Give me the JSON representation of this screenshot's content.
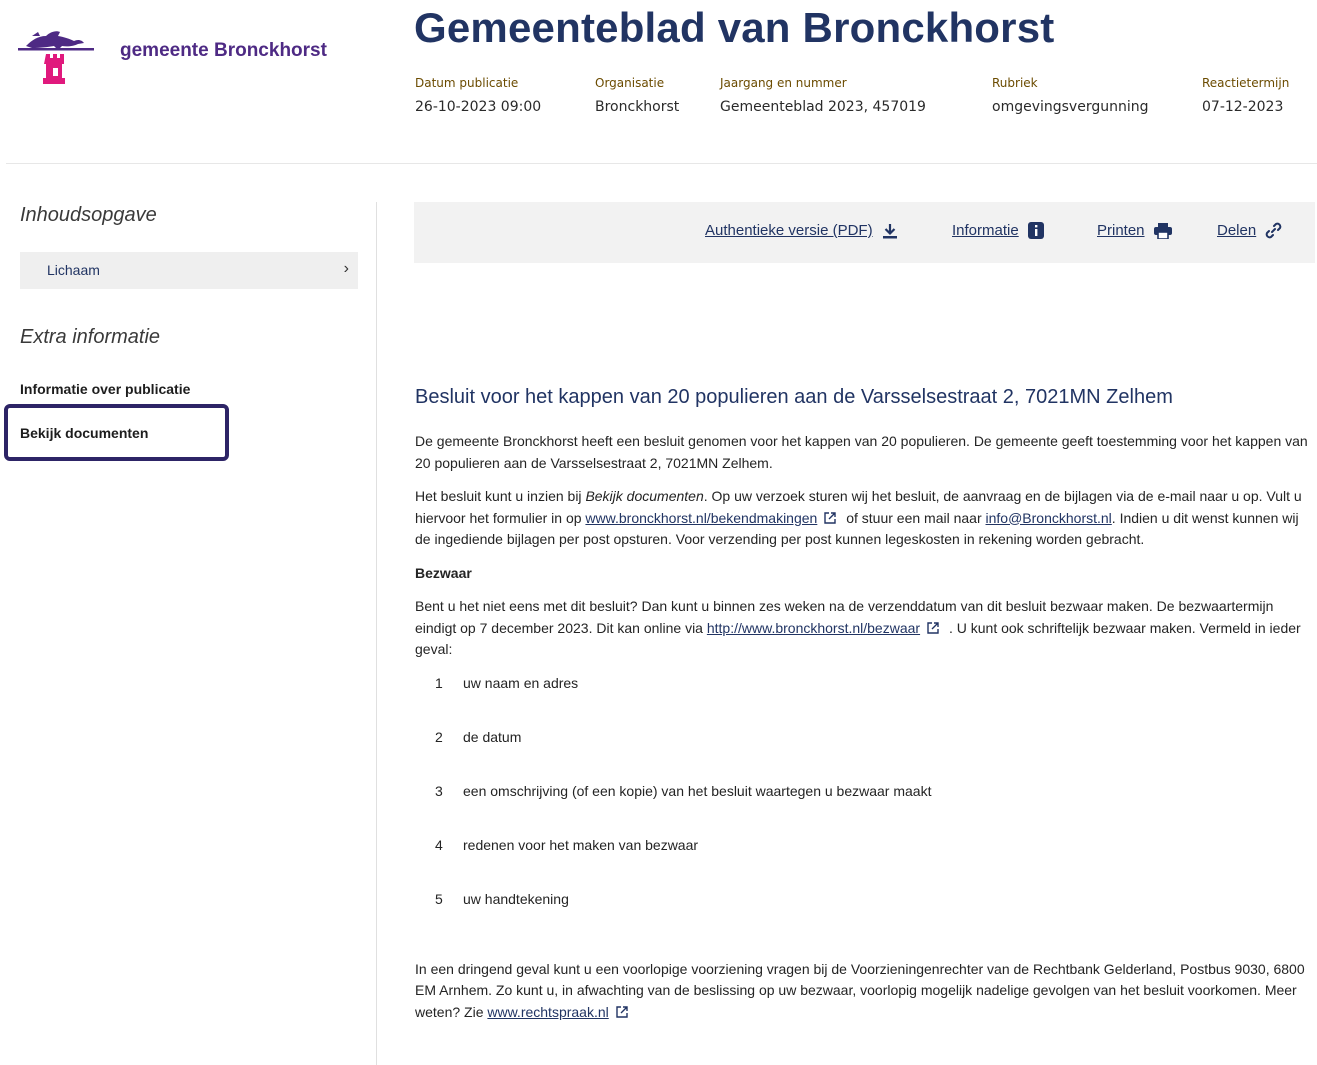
{
  "header": {
    "logo_text": "gemeente Bronckhorst",
    "title": "Gemeenteblad van Bronckhorst",
    "meta": [
      {
        "label": "Datum publicatie",
        "value": "26-10-2023 09:00"
      },
      {
        "label": "Organisatie",
        "value": "Bronckhorst"
      },
      {
        "label": "Jaargang en nummer",
        "value": "Gemeenteblad 2023, 457019"
      },
      {
        "label": "Rubriek",
        "value": "omgevingsvergunning"
      },
      {
        "label": "Reactietermijn",
        "value": "07-12-2023"
      }
    ]
  },
  "sidebar": {
    "toc_heading": "Inhoudsopgave",
    "toc_item": "Lichaam",
    "extra_heading": "Extra informatie",
    "links": [
      "Informatie over publicatie",
      "Bekijk documenten"
    ]
  },
  "toolbar": {
    "pdf": "Authentieke versie (PDF)",
    "info": "Informatie",
    "print": "Printen",
    "share": "Delen"
  },
  "content": {
    "heading": "Besluit voor het kappen van 20 populieren aan de Varsselsestraat 2, 7021MN Zelhem",
    "intro": "De gemeente Bronckhorst heeft een besluit genomen voor het kappen van 20 populieren. De gemeente geeft toestemming voor het kappen van 20 populieren aan de Varsselsestraat 2, 7021MN Zelhem.",
    "p2": {
      "a": "Het besluit kunt u inzien bij ",
      "em": "Bekijk documenten",
      "b": ". Op uw verzoek sturen wij het besluit, de aanvraag en de bijlagen via de e-mail naar u op. Vult u hiervoor het formulier in op ",
      "link1": "www.bronckhorst.nl/bekendmakingen",
      "c": " of stuur een mail naar ",
      "link2": "info@Bronckhorst.nl",
      "d": ". Indien u dit wenst kunnen wij de ingediende bijlagen per post opsturen. Voor verzending per post kunnen legeskosten in rekening worden gebracht."
    },
    "bezwaar_heading": "Bezwaar",
    "p3": {
      "a": "Bent u het niet eens met dit besluit? Dan kunt u binnen zes weken na de verzenddatum van dit besluit bezwaar maken. De bezwaartermijn eindigt op 7 december 2023. Dit kan online via ",
      "link": "http://www.bronckhorst.nl/bezwaar",
      "b": " . U kunt ook schriftelijk bezwaar maken. Vermeld in ieder geval:"
    },
    "steps": [
      {
        "n": "1",
        "text": "uw naam en adres"
      },
      {
        "n": "2",
        "text": "de datum"
      },
      {
        "n": "3",
        "text": "een omschrijving (of een kopie) van het besluit waartegen u bezwaar maakt"
      },
      {
        "n": "4",
        "text": "redenen voor het maken van bezwaar"
      },
      {
        "n": "5",
        "text": "uw handtekening"
      }
    ],
    "p4": {
      "a": "In een dringend geval kunt u een voorlopige voorziening vragen bij de Voorzieningenrechter van de Rechtbank Gelderland, Postbus 9030, 6800 EM Arnhem. Zo kunt u, in afwachting van de beslissing op uw bezwaar, voorlopig mogelijk nadelige gevolgen van het besluit voorkomen. Meer weten? Zie ",
      "link": "www.rechtspraak.nl"
    }
  },
  "colors": {
    "brand_purple": "#4e2a84",
    "navy": "#213463",
    "castle_pink": "#e0197d",
    "highlight": "#2d2466"
  }
}
